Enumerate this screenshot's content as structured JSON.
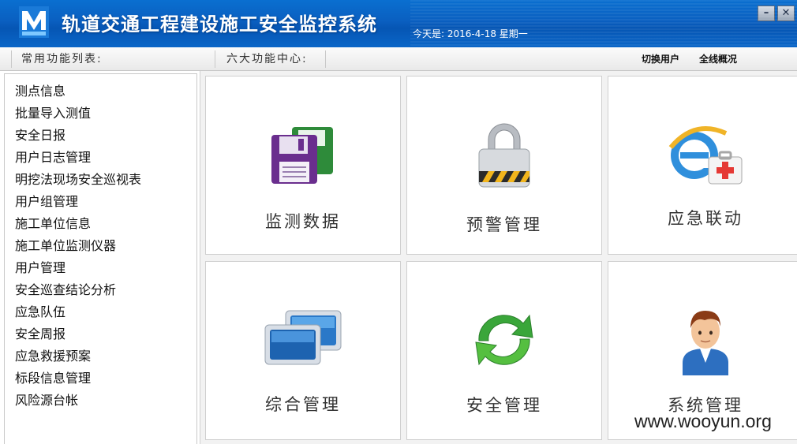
{
  "window": {
    "title": "轨道交通工程建设施工安全监控系统",
    "date_text": "今天是: 2016-4-18 星期一",
    "min_label": "–",
    "close_label": "✕"
  },
  "toolbar": {
    "common_label": "常用功能列表:",
    "center_label": "六大功能中心:",
    "switch_user": "切换用户",
    "overview": "全线概况"
  },
  "sidebar": {
    "items": [
      "测点信息",
      "批量导入测值",
      "安全日报",
      "用户日志管理",
      "明挖法现场安全巡视表",
      "用户组管理",
      "施工单位信息",
      "施工单位监测仪器",
      "用户管理",
      "安全巡查结论分析",
      "应急队伍",
      "安全周报",
      "应急救援预案",
      "标段信息管理",
      "风险源台帐"
    ]
  },
  "tiles": [
    {
      "label": "监测数据",
      "icon": "floppy-disk-icon"
    },
    {
      "label": "预警管理",
      "icon": "padlock-icon"
    },
    {
      "label": "应急联动",
      "icon": "browser-first-aid-icon"
    },
    {
      "label": "综合管理",
      "icon": "monitors-icon"
    },
    {
      "label": "安全管理",
      "icon": "refresh-arrows-icon"
    },
    {
      "label": "系统管理",
      "icon": "user-avatar-icon"
    }
  ],
  "watermark": "www.wooyun.org",
  "colors": {
    "titlebar": "#0a5fc0",
    "toolbar": "#eeeeee",
    "tile_border": "#cfcfcf"
  }
}
